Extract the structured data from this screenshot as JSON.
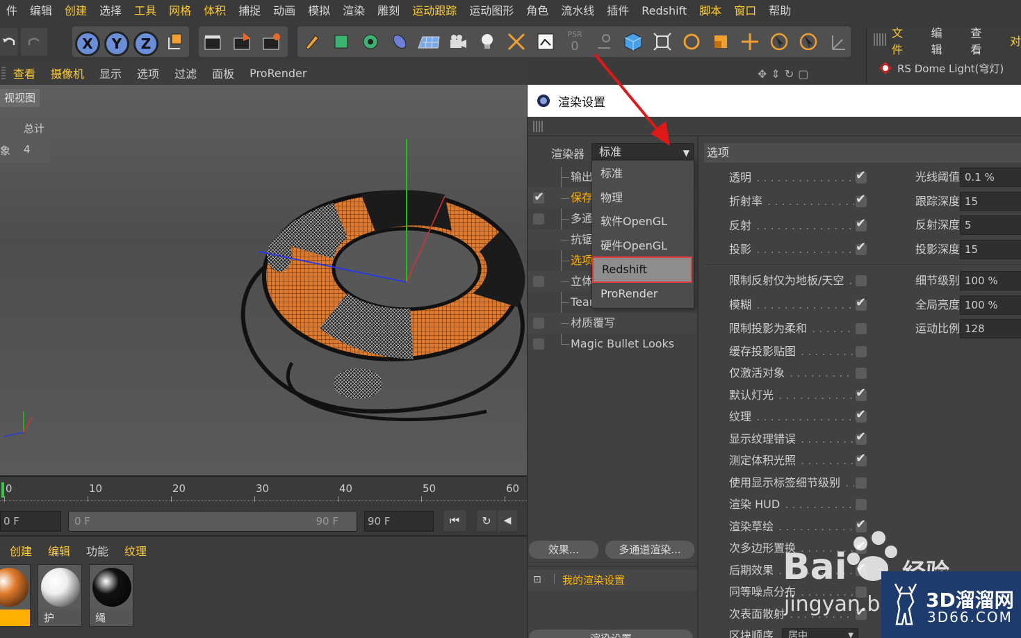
{
  "menubar": {
    "items": [
      {
        "label": "件",
        "hl": false
      },
      {
        "label": "编辑",
        "hl": false
      },
      {
        "label": "创建",
        "hl": true
      },
      {
        "label": "选择",
        "hl": false
      },
      {
        "label": "工具",
        "hl": true
      },
      {
        "label": "网格",
        "hl": true
      },
      {
        "label": "体积",
        "hl": true
      },
      {
        "label": "捕捉",
        "hl": false
      },
      {
        "label": "动画",
        "hl": false
      },
      {
        "label": "模拟",
        "hl": false
      },
      {
        "label": "渲染",
        "hl": false
      },
      {
        "label": "雕刻",
        "hl": false
      },
      {
        "label": "运动跟踪",
        "hl": true
      },
      {
        "label": "运动图形",
        "hl": false
      },
      {
        "label": "角色",
        "hl": false
      },
      {
        "label": "流水线",
        "hl": false
      },
      {
        "label": "插件",
        "hl": false
      },
      {
        "label": "Redshift",
        "hl": false
      },
      {
        "label": "脚本",
        "hl": true
      },
      {
        "label": "窗口",
        "hl": true
      },
      {
        "label": "帮助",
        "hl": false
      }
    ]
  },
  "toolbar": {
    "axis_x": "X",
    "axis_y": "Y",
    "axis_z": "Z",
    "psr_label": "PSR",
    "psr_value": "0"
  },
  "objpanel": {
    "tabs": [
      "文件",
      "编辑",
      "查看",
      "对"
    ],
    "object_name": "RS Dome Light(穹灯)"
  },
  "viewheader": {
    "items": [
      {
        "label": "查看",
        "hl": true
      },
      {
        "label": "摄像机",
        "hl": true
      },
      {
        "label": "显示",
        "hl": false
      },
      {
        "label": "选项",
        "hl": false
      },
      {
        "label": "过滤",
        "hl": false
      },
      {
        "label": "面板",
        "hl": false
      },
      {
        "label": "ProRender",
        "hl": false
      }
    ]
  },
  "viewport": {
    "label": "视视图",
    "stats_header": "总计",
    "stats_label": "象",
    "stats_value": "4"
  },
  "timeline": {
    "ticks": [
      "0",
      "10",
      "20",
      "30",
      "40",
      "50",
      "60"
    ],
    "current_frame": "0 F",
    "range_start": "0 F",
    "range_end": "90 F",
    "end_frame": "90 F"
  },
  "materials": {
    "tabs": [
      {
        "label": "创建",
        "hl": true
      },
      {
        "label": "编辑",
        "hl": true
      },
      {
        "label": "功能",
        "hl": false
      },
      {
        "label": "纹理",
        "hl": true
      }
    ],
    "items": [
      {
        "name": "",
        "color": "#e07a2a"
      },
      {
        "name": "护",
        "color": "#eeeeee"
      },
      {
        "name": "绳",
        "color": "#111111"
      }
    ]
  },
  "dialog": {
    "title": "渲染设置",
    "renderer_label": "渲染器",
    "renderer_value": "标准",
    "renderer_options": [
      "标准",
      "物理",
      "软件OpenGL",
      "硬件OpenGL",
      "Redshift",
      "ProRender"
    ],
    "renderer_selected_index": 4,
    "tree": [
      {
        "label": "输出",
        "check": "none",
        "hl": false
      },
      {
        "label": "保存",
        "check": "on",
        "hl": true
      },
      {
        "label": "多通",
        "check": "off",
        "hl": false
      },
      {
        "label": "抗锯",
        "check": "none",
        "hl": false
      },
      {
        "label": "选项",
        "check": "none",
        "hl": true
      },
      {
        "label": "立体",
        "check": "off",
        "hl": false
      },
      {
        "label": "Team Render",
        "check": "none",
        "hl": false
      },
      {
        "label": "材质覆写",
        "check": "off",
        "hl": false
      },
      {
        "label": "Magic Bullet Looks",
        "check": "off",
        "hl": false
      }
    ],
    "effects_button": "效果...",
    "multipass_button": "多通道渲染...",
    "my_settings": "我的渲染设置",
    "bottom_button": "渲染设置",
    "options_header": "选项",
    "options": [
      {
        "label": "透明",
        "on": true
      },
      {
        "label": "折射率",
        "on": true
      },
      {
        "label": "反射",
        "on": true
      },
      {
        "label": "投影",
        "on": true
      },
      {
        "label": "限制反射仅为地板/天空",
        "on": false
      },
      {
        "label": "模糊",
        "on": true
      },
      {
        "label": "限制投影为柔和",
        "on": false
      },
      {
        "label": "缓存投影贴图",
        "on": false
      },
      {
        "label": "仅激活对象",
        "on": false
      },
      {
        "label": "默认灯光",
        "on": true
      },
      {
        "label": "纹理",
        "on": true
      },
      {
        "label": "显示纹理错误",
        "on": true
      },
      {
        "label": "测定体积光照",
        "on": true
      },
      {
        "label": "使用显示标签细节级别",
        "on": false
      },
      {
        "label": "渲染 HUD",
        "on": false
      },
      {
        "label": "渲染草绘",
        "on": true
      },
      {
        "label": "次多边形置换",
        "on": true
      },
      {
        "label": "后期效果",
        "on": true
      },
      {
        "label": "同等噪点分布",
        "on": false
      },
      {
        "label": "次表面散射",
        "on": true
      },
      {
        "label": "区块顺序",
        "on": false
      }
    ],
    "block_order_value": "居中",
    "numeric": [
      {
        "label": "光线阈值",
        "value": "0.1 %"
      },
      {
        "label": "跟踪深度",
        "value": "15"
      },
      {
        "label": "反射深度",
        "value": "5"
      },
      {
        "label": "投影深度",
        "value": "15"
      },
      {
        "label": "细节级别",
        "value": "100 %"
      },
      {
        "label": "全局亮度",
        "value": "100 %"
      },
      {
        "label": "运动比例",
        "value": "128"
      }
    ]
  },
  "watermark": {
    "baidu": "Bai",
    "baidu2": "经验",
    "baidu_url": "jingyan.ba",
    "site": "3D溜溜网",
    "site_url": "3D66.COM"
  },
  "colors": {
    "accent": "#ffcc33",
    "highlight_red": "#e23b3b",
    "orange": "#e07a2a"
  }
}
